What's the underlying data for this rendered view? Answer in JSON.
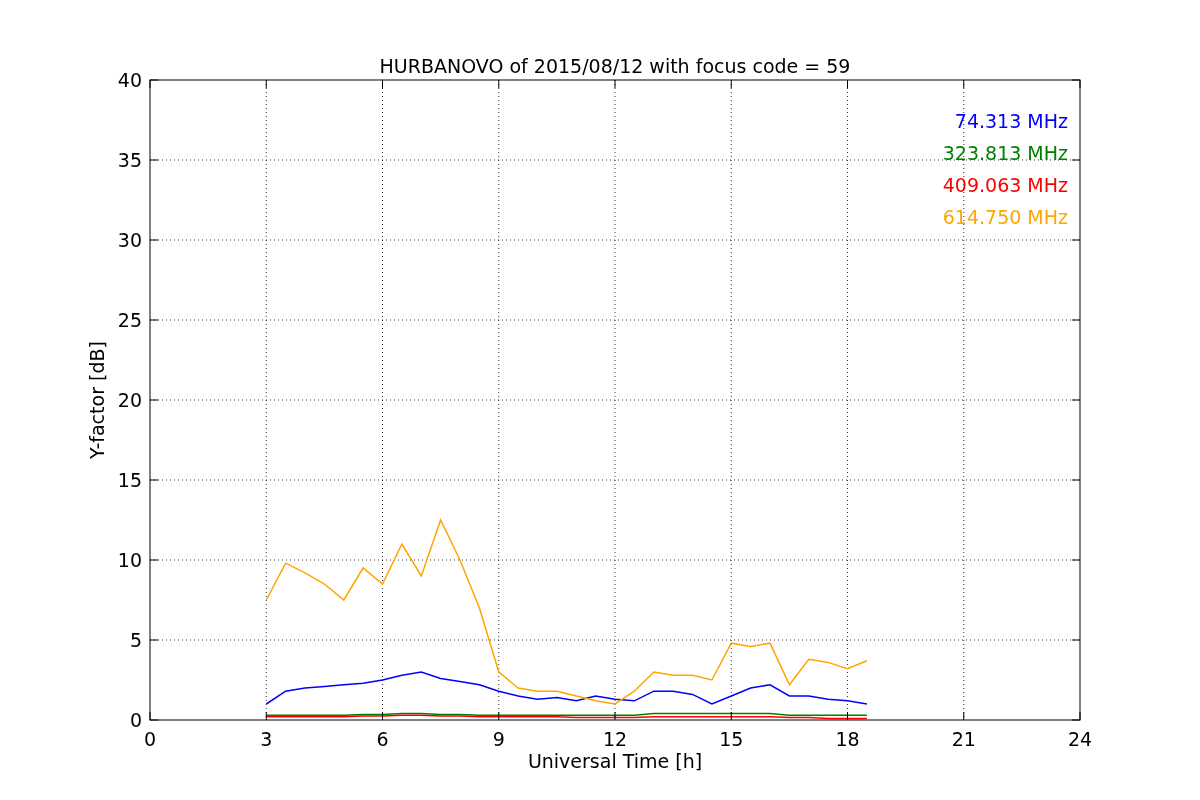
{
  "chart_data": {
    "type": "line",
    "grid": true,
    "title": "HURBANOVO of 2015/08/12 with focus code = 59",
    "xlabel": "Universal Time [h]",
    "ylabel": "Y-factor [dB]",
    "xlim": [
      0,
      24
    ],
    "ylim": [
      0,
      40
    ],
    "xticks": [
      0,
      3,
      6,
      9,
      12,
      15,
      18,
      21,
      24
    ],
    "yticks": [
      0,
      5,
      10,
      15,
      20,
      25,
      30,
      35,
      40
    ],
    "x": [
      3,
      3.5,
      4,
      4.5,
      5,
      5.5,
      6,
      6.5,
      7,
      7.5,
      8,
      8.5,
      9,
      9.5,
      10,
      10.5,
      11,
      11.5,
      12,
      12.5,
      13,
      13.5,
      14,
      14.5,
      15,
      15.5,
      16,
      16.5,
      17,
      17.5,
      18,
      18.5
    ],
    "series": [
      {
        "name": "74.313 MHz",
        "color": "#0000ff",
        "values": [
          1,
          1.8,
          2,
          2.1,
          2.2,
          2.3,
          2.5,
          2.8,
          3,
          2.6,
          2.4,
          2.2,
          1.8,
          1.5,
          1.3,
          1.4,
          1.2,
          1.5,
          1.3,
          1.2,
          1.8,
          1.8,
          1.6,
          1,
          1.5,
          2,
          2.2,
          1.5,
          1.5,
          1.3,
          1.2,
          1
        ]
      },
      {
        "name": "323.813 MHz",
        "color": "#008000",
        "values": [
          0.3,
          0.3,
          0.3,
          0.3,
          0.3,
          0.35,
          0.35,
          0.4,
          0.4,
          0.35,
          0.35,
          0.3,
          0.3,
          0.3,
          0.3,
          0.3,
          0.3,
          0.3,
          0.3,
          0.3,
          0.4,
          0.4,
          0.4,
          0.4,
          0.4,
          0.4,
          0.4,
          0.3,
          0.3,
          0.3,
          0.3,
          0.3
        ]
      },
      {
        "name": "409.063 MHz",
        "color": "#ff0000",
        "values": [
          0.2,
          0.2,
          0.2,
          0.2,
          0.2,
          0.25,
          0.25,
          0.3,
          0.3,
          0.25,
          0.25,
          0.2,
          0.2,
          0.2,
          0.2,
          0.2,
          0.15,
          0.15,
          0.15,
          0.15,
          0.2,
          0.2,
          0.2,
          0.2,
          0.2,
          0.2,
          0.2,
          0.15,
          0.15,
          0.1,
          0.1,
          0.1
        ]
      },
      {
        "name": "614.750 MHz",
        "color": "#ffa500",
        "values": [
          7.5,
          9.8,
          9.2,
          8.5,
          7.5,
          9.5,
          8.5,
          11,
          9,
          12.5,
          10,
          7,
          3,
          2,
          1.8,
          1.8,
          1.5,
          1.2,
          1,
          1.8,
          3,
          2.8,
          2.8,
          2.5,
          4.8,
          4.6,
          4.8,
          2.2,
          3.8,
          3.6,
          3.2,
          3.7
        ]
      }
    ]
  }
}
